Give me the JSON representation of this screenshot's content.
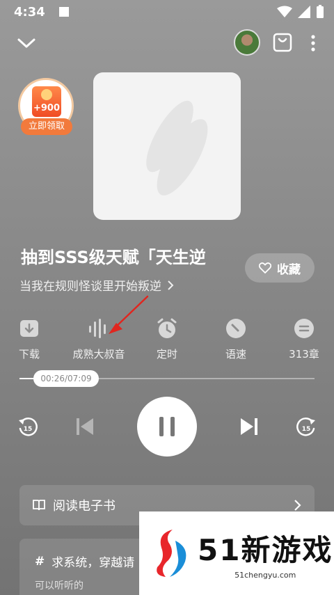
{
  "status_bar": {
    "time": "4:34"
  },
  "coin_badge": {
    "amount": "+900",
    "label": "立即领取"
  },
  "book": {
    "title": "抽到SSS级天赋「天生逆",
    "subtitle": "当我在规则怪谈里开始叛逆",
    "favorite_label": "收藏"
  },
  "actions": [
    {
      "label": "下载",
      "icon": "download-icon"
    },
    {
      "label": "成熟大叔音",
      "icon": "voice-icon"
    },
    {
      "label": "定时",
      "icon": "alarm-icon"
    },
    {
      "label": "语速",
      "icon": "speed-icon"
    },
    {
      "label": "313章",
      "icon": "chapters-icon"
    }
  ],
  "progress": {
    "time_text": "00:26/07:09",
    "fraction": 0.06
  },
  "controls": {
    "rewind_seconds": "15",
    "forward_seconds": "15"
  },
  "ebook": {
    "label": "阅读电子书"
  },
  "comment": {
    "title": "求系统，穿越请",
    "subtitle": "可以听听的"
  },
  "watermark": {
    "title": "51新游戏",
    "url": "51chengyu.com"
  },
  "colors": {
    "accent_orange": "#f27a3c",
    "annotation_red": "#e0261f"
  }
}
